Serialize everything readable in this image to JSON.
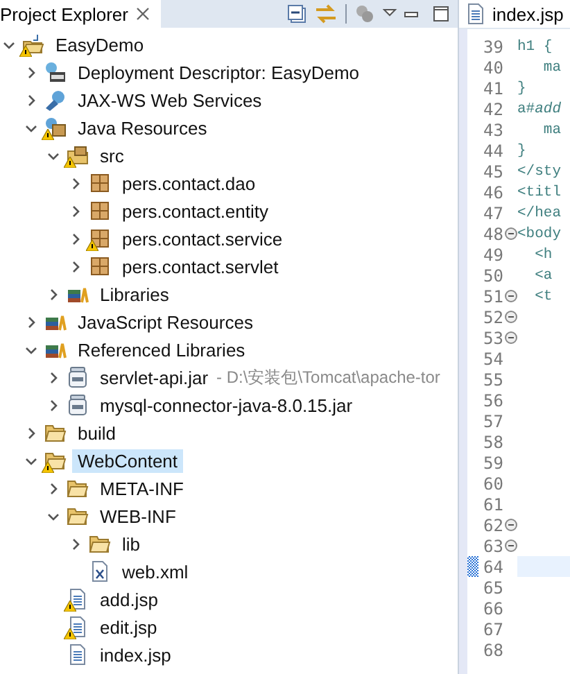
{
  "explorer": {
    "title": "Project Explorer",
    "tree": [
      {
        "label": "EasyDemo",
        "kind": "project",
        "warning": true,
        "expanded": true,
        "selected": false,
        "children": [
          {
            "label": "Deployment Descriptor: EasyDemo",
            "kind": "descriptor",
            "warning": false,
            "expanded": false,
            "selected": false
          },
          {
            "label": "JAX-WS Web Services",
            "kind": "webservices",
            "warning": false,
            "expanded": false,
            "selected": false
          },
          {
            "label": "Java Resources",
            "kind": "javares",
            "warning": true,
            "expanded": true,
            "selected": false,
            "children": [
              {
                "label": "src",
                "kind": "srcfolder",
                "warning": true,
                "expanded": true,
                "selected": false,
                "children": [
                  {
                    "label": "pers.contact.dao",
                    "kind": "package",
                    "warning": false,
                    "expanded": false,
                    "selected": false
                  },
                  {
                    "label": "pers.contact.entity",
                    "kind": "package",
                    "warning": false,
                    "expanded": false,
                    "selected": false
                  },
                  {
                    "label": "pers.contact.service",
                    "kind": "package",
                    "warning": true,
                    "expanded": false,
                    "selected": false
                  },
                  {
                    "label": "pers.contact.servlet",
                    "kind": "package",
                    "warning": false,
                    "expanded": false,
                    "selected": false
                  }
                ]
              },
              {
                "label": "Libraries",
                "kind": "library",
                "warning": false,
                "expanded": false,
                "selected": false
              }
            ]
          },
          {
            "label": "JavaScript Resources",
            "kind": "library",
            "warning": false,
            "expanded": false,
            "selected": false
          },
          {
            "label": "Referenced Libraries",
            "kind": "library",
            "warning": false,
            "expanded": true,
            "selected": false,
            "children": [
              {
                "label": "servlet-api.jar",
                "suffix": "- D:\\安装包\\Tomcat\\apache-tor",
                "kind": "jar",
                "warning": false,
                "expanded": false,
                "selected": false
              },
              {
                "label": "mysql-connector-java-8.0.15.jar",
                "kind": "jar",
                "warning": false,
                "expanded": false,
                "selected": false
              }
            ]
          },
          {
            "label": "build",
            "kind": "folder",
            "warning": false,
            "expanded": false,
            "selected": false
          },
          {
            "label": "WebContent",
            "kind": "folder",
            "warning": true,
            "expanded": true,
            "selected": true,
            "children": [
              {
                "label": "META-INF",
                "kind": "folder",
                "warning": false,
                "expanded": false,
                "selected": false
              },
              {
                "label": "WEB-INF",
                "kind": "folder",
                "warning": false,
                "expanded": true,
                "selected": false,
                "children": [
                  {
                    "label": "lib",
                    "kind": "folder",
                    "warning": false,
                    "expanded": false,
                    "selected": false
                  },
                  {
                    "label": "web.xml",
                    "kind": "xml",
                    "warning": false,
                    "selected": false
                  }
                ]
              },
              {
                "label": "add.jsp",
                "kind": "jsp",
                "warning": true,
                "selected": false
              },
              {
                "label": "edit.jsp",
                "kind": "jsp",
                "warning": true,
                "selected": false
              },
              {
                "label": "index.jsp",
                "kind": "jsp",
                "warning": false,
                "selected": false
              }
            ]
          }
        ]
      }
    ]
  },
  "editor": {
    "tab": "index.jsp",
    "lines": [
      {
        "number": "39",
        "code": "h1 {",
        "fold": false,
        "current": false
      },
      {
        "number": "40",
        "code": "   ma",
        "fold": false,
        "current": false
      },
      {
        "number": "41",
        "code": "}",
        "fold": false,
        "current": false
      },
      {
        "number": "42",
        "code": "a#*add*",
        "fold": false,
        "current": false
      },
      {
        "number": "43",
        "code": "   ma",
        "fold": false,
        "current": false
      },
      {
        "number": "44",
        "code": "}",
        "fold": false,
        "current": false
      },
      {
        "number": "45",
        "code": "</sty",
        "fold": false,
        "current": false
      },
      {
        "number": "46",
        "code": "<titl",
        "fold": false,
        "current": false
      },
      {
        "number": "47",
        "code": "</hea",
        "fold": false,
        "current": false
      },
      {
        "number": "48",
        "code": "<body",
        "fold": true,
        "current": false
      },
      {
        "number": "49",
        "code": "  <h",
        "fold": false,
        "current": false
      },
      {
        "number": "50",
        "code": "  <a",
        "fold": false,
        "current": false
      },
      {
        "number": "51",
        "code": "  <t",
        "fold": true,
        "current": false
      },
      {
        "number": "52",
        "fold": true,
        "current": false
      },
      {
        "number": "53",
        "fold": true,
        "current": false
      },
      {
        "number": "54",
        "fold": false,
        "current": false
      },
      {
        "number": "55",
        "fold": false,
        "current": false
      },
      {
        "number": "56",
        "fold": false,
        "current": false
      },
      {
        "number": "57",
        "fold": false,
        "current": false
      },
      {
        "number": "58",
        "fold": false,
        "current": false
      },
      {
        "number": "59",
        "fold": false,
        "current": false
      },
      {
        "number": "60",
        "fold": false,
        "current": false
      },
      {
        "number": "61",
        "fold": false,
        "current": false
      },
      {
        "number": "62",
        "fold": true,
        "current": false
      },
      {
        "number": "63",
        "fold": true,
        "current": false
      },
      {
        "number": "64",
        "fold": false,
        "current": true
      },
      {
        "number": "65",
        "fold": false,
        "current": false
      },
      {
        "number": "66",
        "fold": false,
        "current": false
      },
      {
        "number": "67",
        "fold": false,
        "current": false
      },
      {
        "number": "68",
        "fold": false,
        "current": false
      }
    ]
  }
}
